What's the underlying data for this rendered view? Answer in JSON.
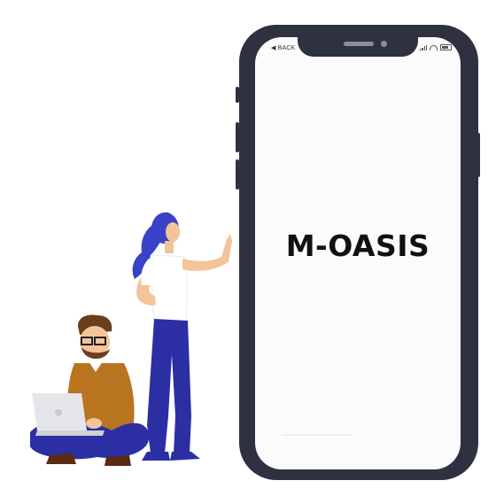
{
  "status_bar": {
    "back_label": "BACK",
    "back_icon": "back-triangle-icon",
    "right_icons": [
      "signal-icon",
      "wifi-icon",
      "battery-icon"
    ]
  },
  "app": {
    "name": "M-OASIS"
  },
  "illustration": {
    "people": [
      "man-with-laptop",
      "woman-pointing"
    ],
    "colors": {
      "phone_frame": "#2e3140",
      "navy_clothes": "#2b2fa3",
      "hair_blue": "#3a43c7",
      "sweater": "#b8741f",
      "skin": "#f3c49a",
      "beard": "#6b3f1c"
    }
  }
}
